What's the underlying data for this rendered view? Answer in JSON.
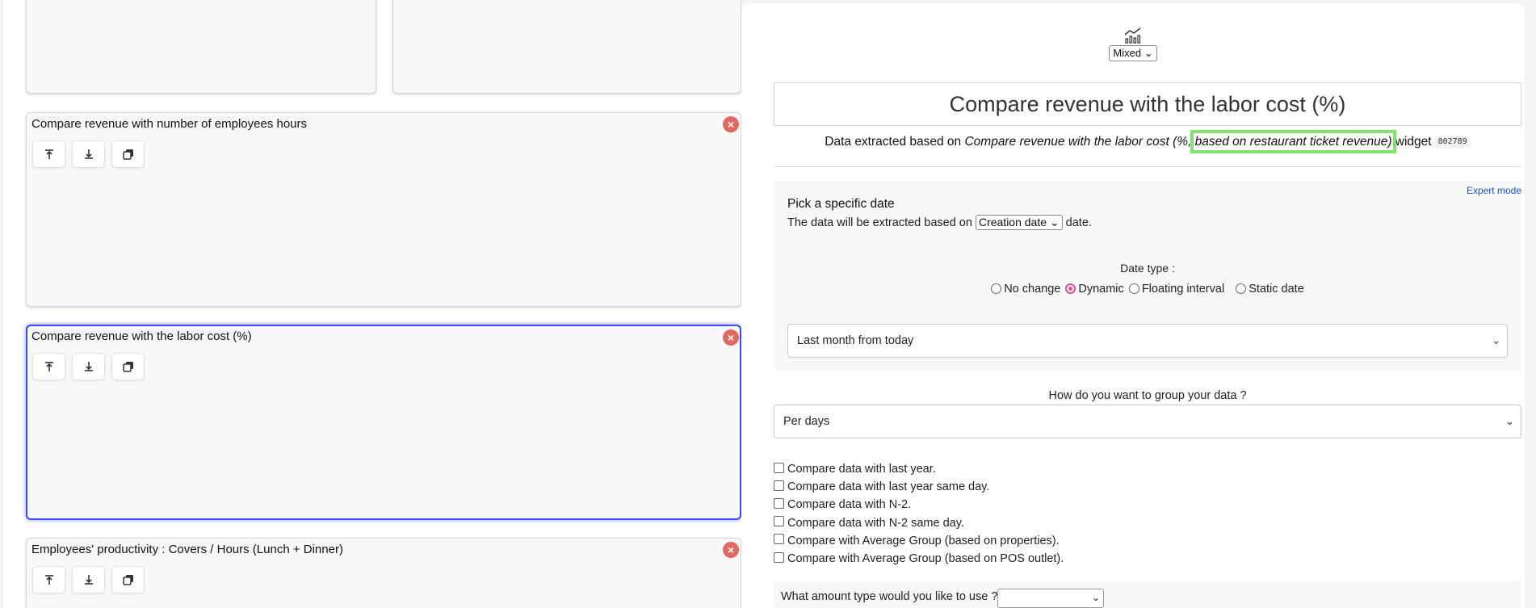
{
  "widgets": [
    {
      "title": "",
      "selected": false
    },
    {
      "title": "",
      "selected": false
    },
    {
      "title": "Compare revenue with number of employees hours",
      "selected": false
    },
    {
      "title": "Compare revenue with the labor cost (%)",
      "selected": true
    },
    {
      "title": "Employees' productivity : Covers / Hours (Lunch + Dinner)",
      "selected": false
    }
  ],
  "widget_actions": {
    "move_top_icon": "arrow-to-top-icon",
    "move_bottom_icon": "arrow-to-bottom-icon",
    "duplicate_icon": "copy-icon",
    "remove_icon": "close-icon",
    "remove_glyph": "×"
  },
  "editor": {
    "chart_type_icon": "mixed-chart-icon",
    "chart_type_value": "Mixed",
    "chart_type_chevron": "⌄",
    "title": "Compare revenue with the labor cost (%)",
    "extract": {
      "prefix": "Data extracted based on ",
      "source_part1": "Compare revenue with the labor cost (%, ",
      "source_part2": "based on restaurant ticket revenue)",
      "suffix": " widget",
      "widget_id": "802789"
    },
    "expert_mode": "Expert mode",
    "date": {
      "title": "Pick a specific date",
      "desc_prefix": "The data will be extracted based on ",
      "date_field": "Creation date",
      "desc_suffix": " date.",
      "date_type_label": "Date type :",
      "radios": [
        "No change",
        "Dynamic",
        "Floating interval",
        "Static date"
      ],
      "selected_radio": "Dynamic",
      "range": "Last month from today"
    },
    "group": {
      "label": "How do you want to group your data ?",
      "value": "Per days"
    },
    "compare_options": [
      "Compare data with last year.",
      "Compare data with last year same day.",
      "Compare data with N-2.",
      "Compare data with N-2 same day.",
      "Compare with Average Group (based on properties).",
      "Compare with Average Group (based on POS outlet)."
    ],
    "amount_type_label": "What amount type would you like to use ?",
    "amount_type_value": ""
  },
  "colors": {
    "accent_selected": "#3a4cf0",
    "remove": "#e06a62",
    "highlight": "#7ee46d",
    "radio_on": "#e14c98",
    "link": "#1f4fd9"
  }
}
